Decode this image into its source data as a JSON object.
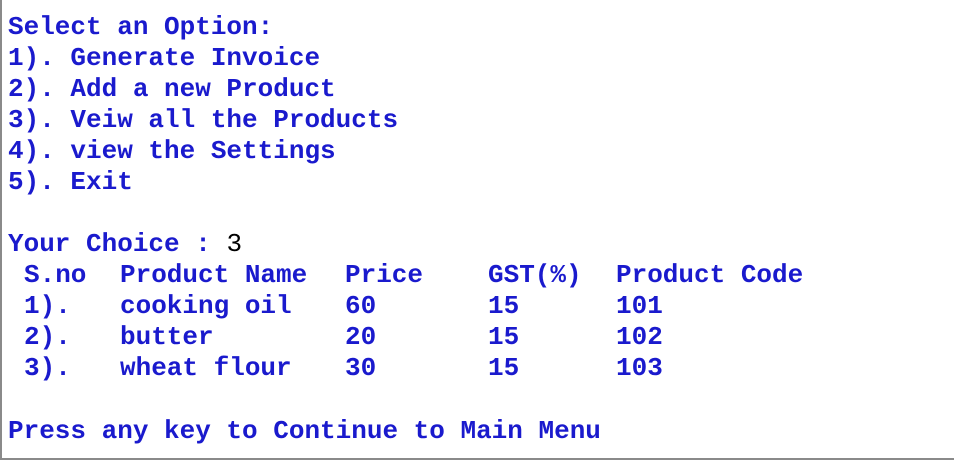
{
  "console": {
    "menu_title": "Select an Option:",
    "menu_items": [
      "1). Generate Invoice",
      "2). Add a new Product",
      "3). Veiw all the Products",
      "4). view the Settings",
      "5). Exit"
    ],
    "choice_prompt": "Your Choice : ",
    "choice_value": "3",
    "table": {
      "headers": [
        "S.no",
        "Product Name",
        "Price",
        "GST(%)",
        "Product Code"
      ],
      "rows": [
        [
          "1).",
          "cooking oil",
          "60",
          "15",
          "101"
        ],
        [
          "2).",
          "butter",
          "20",
          "15",
          "102"
        ],
        [
          "3).",
          "wheat flour",
          "30",
          "15",
          "103"
        ]
      ]
    },
    "continue_prompt": "Press any key to Continue to Main Menu",
    "colors": {
      "text": "#1a1acd",
      "input": "#000000",
      "background": "#ffffff"
    }
  }
}
